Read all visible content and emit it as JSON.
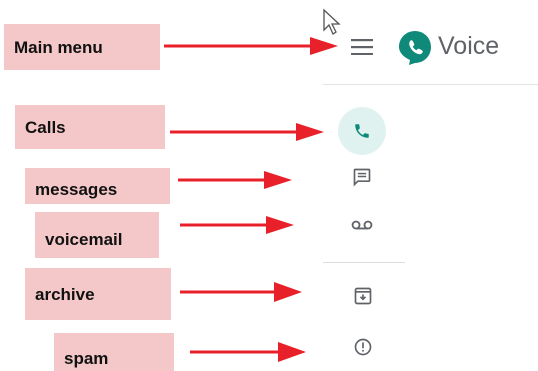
{
  "annotations": {
    "main_menu": "Main menu",
    "calls": "Calls",
    "messages": "messages",
    "voicemail": "voicemail",
    "archive": "archive",
    "spam": "spam"
  },
  "header": {
    "app_name": "Voice"
  },
  "colors": {
    "label_bg": "#f4c8c8",
    "arrow": "#e8202a",
    "brand_green": "#0f8a7a",
    "active_bg": "#e0f2ef",
    "icon_gray": "#5f6368"
  },
  "icons": {
    "menu": "hamburger-menu-icon",
    "logo": "google-voice-logo",
    "calls": "phone-icon",
    "messages": "message-icon",
    "voicemail": "voicemail-icon",
    "archive": "archive-icon",
    "spam": "spam-icon",
    "cursor": "mouse-cursor-icon"
  }
}
